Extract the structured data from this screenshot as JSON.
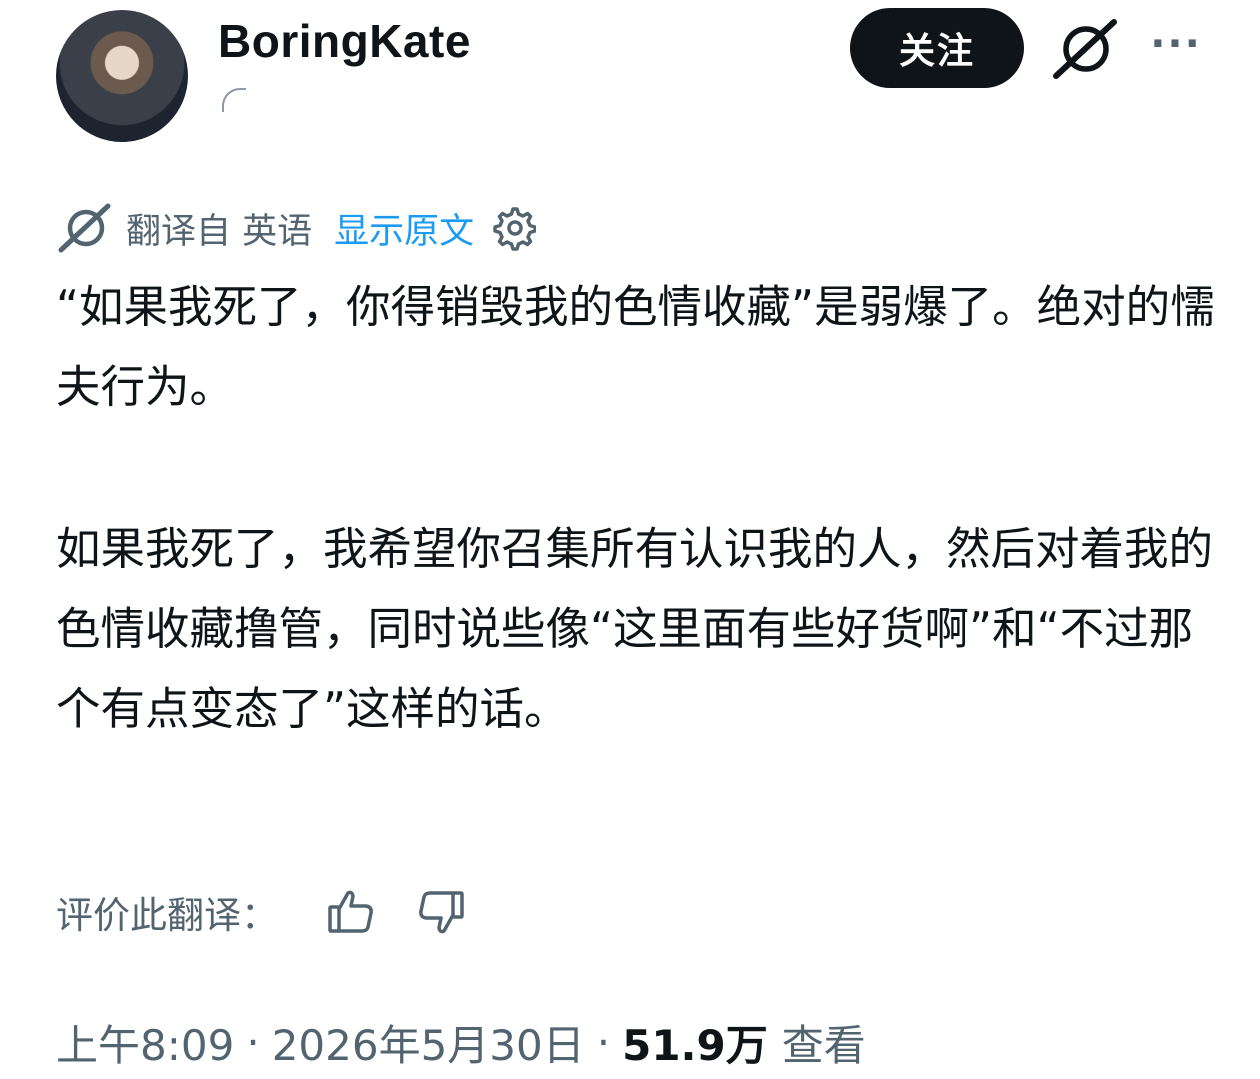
{
  "post": {
    "author_name": "BoringKate",
    "follow_label": "关注",
    "more_label": "···"
  },
  "translation": {
    "translated_from": "翻译自 英语",
    "show_original": "显示原文"
  },
  "content": {
    "paragraph_1": "“如果我死了，你得销毁我的色情收藏”是弱爆了。绝对的懦夫行为。",
    "paragraph_2": "如果我死了，我希望你召集所有认识我的人，然后对着我的色情收藏撸管，同时说些像“这里面有些好货啊”和“不过那个有点变态了”这样的话。"
  },
  "rating": {
    "label": "评价此翻译："
  },
  "meta": {
    "time": "上午8:09",
    "separator": "·",
    "date": "2026年5月30日",
    "views_count": "51.9万",
    "views_label": "查看"
  },
  "icons": {
    "avatar": "avatar-photo",
    "grok": "grok-icon",
    "more": "more-icon",
    "settings": "gear-icon",
    "thumbs_up": "thumbs-up-icon",
    "thumbs_down": "thumbs-down-icon"
  },
  "colors": {
    "text_primary": "#0f1419",
    "text_secondary": "#536471",
    "link": "#1d9bf0",
    "follow_button_bg": "#0f1419"
  }
}
